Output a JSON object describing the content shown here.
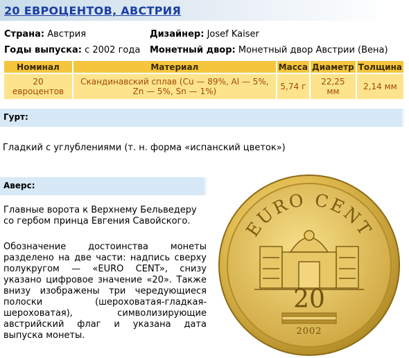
{
  "title": "20 ЕВРОЦЕНТОВ, АВСТРИЯ",
  "info": {
    "country_label": "Страна:",
    "country_value": "Австрия",
    "designer_label": "Дизайнер:",
    "designer_value": "Josef Kaiser",
    "years_label": "Годы выпуска:",
    "years_value": "с 2002 года",
    "mint_label": "Монетный двор:",
    "mint_value": "Монетный двор Австрии (Вена)"
  },
  "spec_table": {
    "headers": [
      "Номинал",
      "Материал",
      "Масса",
      "Диаметр",
      "Толщина"
    ],
    "row": {
      "nominal_1": "20",
      "nominal_2": "евроцентов",
      "material_1": "Скандинавский сплав (Cu — 89%, Al — 5%,",
      "material_2": "Zn — 5%, Sn — 1%)",
      "mass": "5,74 г",
      "diameter_1": "22,25",
      "diameter_2": "мм",
      "thickness": "2,14 мм"
    }
  },
  "edge": {
    "label": "Гурт:",
    "text": "Гладкий с углублениями (т. н. форма «испанский цветок»)"
  },
  "obverse": {
    "label": "Аверс:",
    "text_1": "Главные ворота к Верхнему Бельведеру со гербом принца Евгения Савойского.",
    "text_2": "Обозначение достоинства монеты разделено на две части: надпись сверху полукругом — «EURO CENT», снизу указано цифровое значение «20». Также внизу изображены три чередующиеся полоски (шероховатая-гладкая-шероховатая), символизирующие австрийский флаг и указана дата выпуска монеты."
  },
  "coin": {
    "legend": "EURO CENT",
    "value": "20",
    "year": "2002"
  }
}
